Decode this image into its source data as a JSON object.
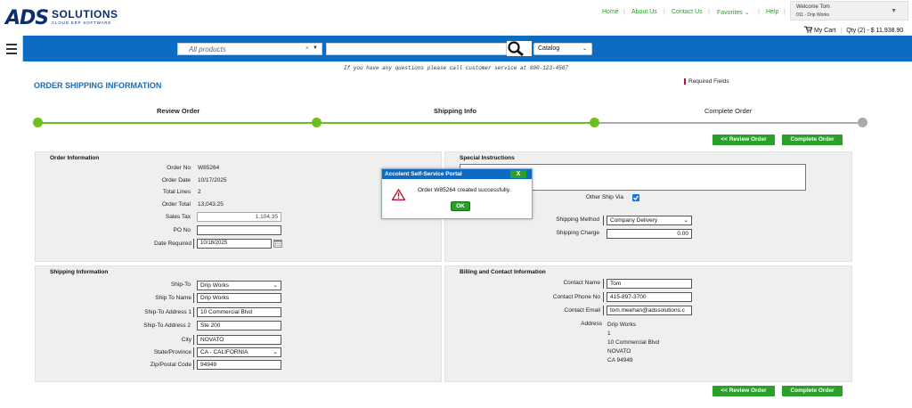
{
  "header": {
    "logo_mark": "ADS",
    "logo_text": "SOLUTIONS",
    "logo_tagline": "CLOUD ERP SOFTWARE",
    "nav": [
      "Home",
      "About Us",
      "Contact Us",
      "Favorites",
      "Help"
    ],
    "welcome_line1": "Welcome Tom",
    "welcome_line2": "011 - Drip Works",
    "cart_label": "My Cart",
    "cart_qty": "Qty (2) - $ 11,938.90"
  },
  "searchbar": {
    "product_filter": "All products",
    "search_value": "",
    "catalog_select": "Catalog"
  },
  "notice": "If you have any questions please call customer service at 800-123-4567",
  "page_title": "ORDER SHIPPING INFORMATION",
  "required_fields": "Required Fields",
  "steps": [
    "Review Order",
    "Shipping Info",
    "Complete Order"
  ],
  "buttons": {
    "review": "<< Review Order",
    "complete": "Complete Order"
  },
  "order_info": {
    "title": "Order Information",
    "order_no_label": "Order No",
    "order_no": "W85264",
    "order_date_label": "Order Date",
    "order_date": "10/17/2025",
    "total_lines_label": "Total Lines",
    "total_lines": "2",
    "order_total_label": "Order Total",
    "order_total": "13,043.25",
    "sales_tax_label": "Sales Tax",
    "sales_tax": "1,104.35",
    "po_no_label": "PO No",
    "po_no": "",
    "date_required_label": "Date Required",
    "date_required": "10/18/2025"
  },
  "special": {
    "title": "Special Instructions",
    "instructions": "",
    "other_ship_via_label": "Other Ship Via",
    "shipping_method_label": "Shipping Method",
    "shipping_method": "Company Delivery",
    "shipping_charge_label": "Shipping Charge",
    "shipping_charge": "0.00"
  },
  "shipping": {
    "title": "Shipping Information",
    "ship_to_label": "Ship-To",
    "ship_to": "Drip Works",
    "ship_to_name_label": "Ship To Name",
    "ship_to_name": "Drip Works",
    "addr1_label": "Ship-To Address 1",
    "addr1": "10 Commercial Blvd",
    "addr2_label": "Ship-To Address 2",
    "addr2": "Ste 200",
    "city_label": "City",
    "city": "NOVATO",
    "state_label": "State/Province",
    "state": "CA - CALIFORNIA",
    "zip_label": "Zip/Postal Code",
    "zip": "94949"
  },
  "billing": {
    "title": "Billing and Contact Information",
    "contact_name_label": "Contact Name",
    "contact_name": "Tom",
    "contact_phone_label": "Contact Phone No",
    "contact_phone": "415-897-3700",
    "contact_email_label": "Contact Email",
    "contact_email": "tom.meehan@adssolutions.c",
    "address_label": "Address",
    "address_lines": [
      "Drip Works",
      "1",
      "10 Commercial Blvd",
      "NOVATO",
      "CA 94949"
    ]
  },
  "modal": {
    "title": "Accolent Self-Service Portal",
    "close": "X",
    "message": "Order W85264 created successfully.",
    "ok": "OK"
  },
  "colors": {
    "accent_green": "#2aa02a",
    "brand_blue": "#0c6cc4",
    "title_blue": "#1a6db5",
    "required_red": "#c8102e"
  }
}
